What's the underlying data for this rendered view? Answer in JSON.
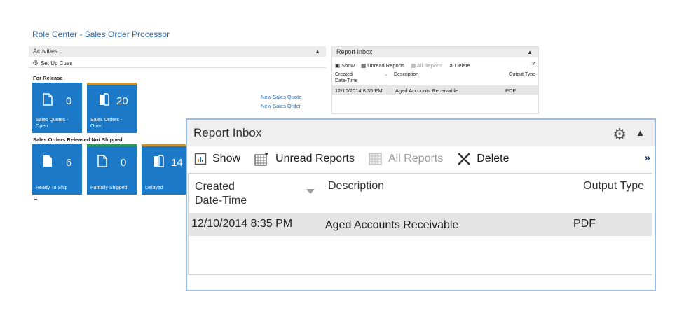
{
  "page_title": "Role Center - Sales Order Processor",
  "activities": {
    "header": "Activities",
    "setup_cues": "Set Up Cues",
    "group1": {
      "caption": "For Release",
      "tiles": [
        {
          "count": "0",
          "label_line1": "Sales Quotes -",
          "label_line2": "Open"
        },
        {
          "count": "20",
          "label_line1": "Sales Orders -",
          "label_line2": "Open"
        }
      ],
      "links": [
        "New Sales Quote",
        "New Sales Order"
      ]
    },
    "group2": {
      "caption": "Sales Orders Released Not Shipped",
      "tiles": [
        {
          "count": "6",
          "label": "Ready To Ship"
        },
        {
          "count": "0",
          "label": "Partially Shipped"
        },
        {
          "count": "14",
          "label": "Delayed"
        }
      ]
    },
    "tile_color": "#1b79c7",
    "stripe_color": "#c8963a"
  },
  "report_inbox": {
    "title": "Report Inbox",
    "toolbar": {
      "show": "Show",
      "unread_reports": "Unread Reports",
      "all_reports": "All Reports",
      "delete": "Delete",
      "more": "»"
    },
    "columns": {
      "created_line1": "Created",
      "created_line2": "Date-Time",
      "description": "Description",
      "output_type": "Output Type"
    },
    "rows": [
      {
        "created": "12/10/2014 8:35 PM",
        "description": "Aged Accounts Receivable",
        "output_type": "PDF"
      }
    ]
  }
}
